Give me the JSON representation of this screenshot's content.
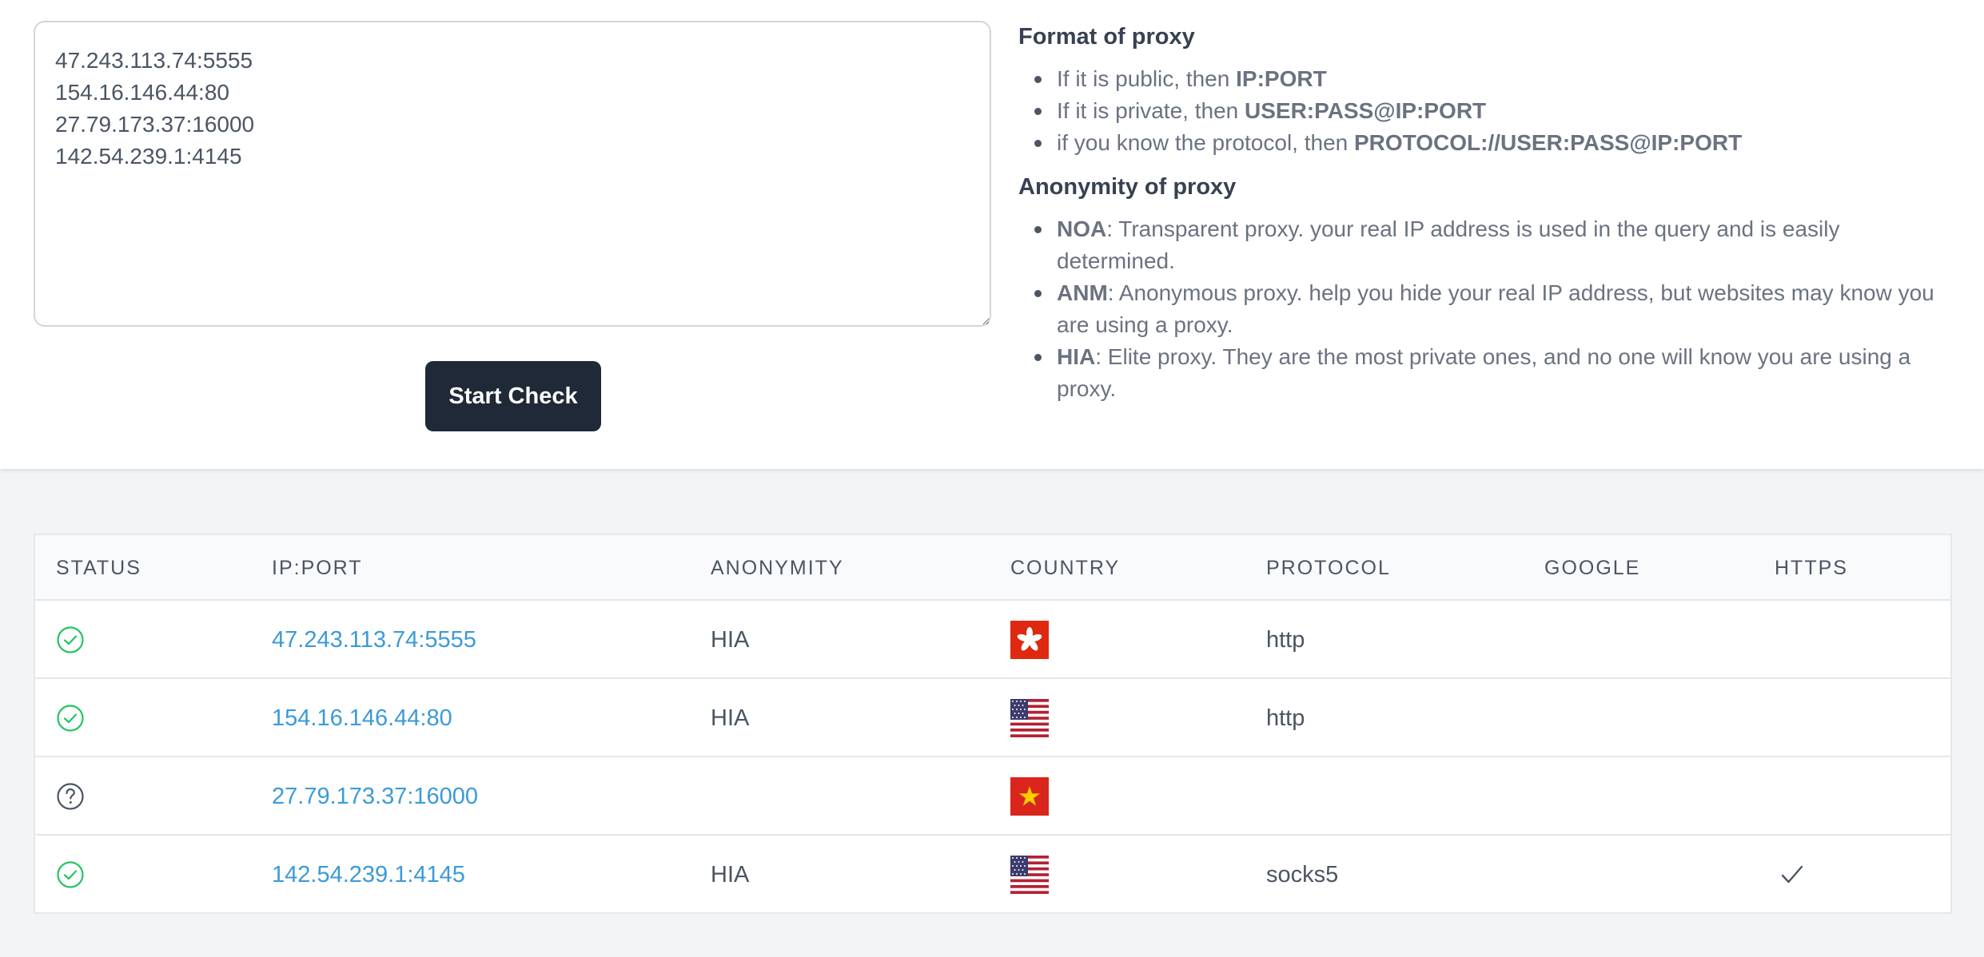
{
  "checker": {
    "textarea_value": "47.243.113.74:5555\n154.16.146.44:80\n27.79.173.37:16000\n142.54.239.1:4145",
    "start_button": "Start Check"
  },
  "help": {
    "format_title": "Format of proxy",
    "format_items": [
      {
        "text": "If it is public, then ",
        "bold": "IP:PORT"
      },
      {
        "text": "If it is private, then ",
        "bold": "USER:PASS@IP:PORT"
      },
      {
        "text": "if you know the protocol, then ",
        "bold": "PROTOCOL://USER:PASS@IP:PORT"
      }
    ],
    "anon_title": "Anonymity of proxy",
    "anon_items": [
      {
        "bold": "NOA",
        "text": ": Transparent proxy. your real IP address is used in the query and is easily determined."
      },
      {
        "bold": "ANM",
        "text": ": Anonymous proxy. help you hide your real IP address, but websites may know you are using a proxy."
      },
      {
        "bold": "HIA",
        "text": ": Elite proxy. They are the most private ones, and no one will know you are using a proxy."
      }
    ]
  },
  "table": {
    "headers": {
      "status": "STATUS",
      "ip_port": "IP:PORT",
      "anonymity": "ANONYMITY",
      "country": "COUNTRY",
      "protocol": "PROTOCOL",
      "google": "GOOGLE",
      "https": "HTTPS"
    },
    "rows": [
      {
        "status": "ok",
        "ip_port": "47.243.113.74:5555",
        "anonymity": "HIA",
        "country_flag": "hk-flag",
        "protocol": "http",
        "google": "",
        "https": false
      },
      {
        "status": "ok",
        "ip_port": "154.16.146.44:80",
        "anonymity": "HIA",
        "country_flag": "us-flag",
        "protocol": "http",
        "google": "",
        "https": false
      },
      {
        "status": "unknown",
        "ip_port": "27.79.173.37:16000",
        "anonymity": "",
        "country_flag": "vn-flag",
        "protocol": "",
        "google": "",
        "https": false
      },
      {
        "status": "ok",
        "ip_port": "142.54.239.1:4145",
        "anonymity": "HIA",
        "country_flag": "us-flag",
        "protocol": "socks5",
        "google": "",
        "https": true
      }
    ]
  },
  "colors": {
    "ok": "#22c55e",
    "unknown": "#4b5563",
    "link": "#3b9ad9",
    "button": "#1f2937"
  }
}
